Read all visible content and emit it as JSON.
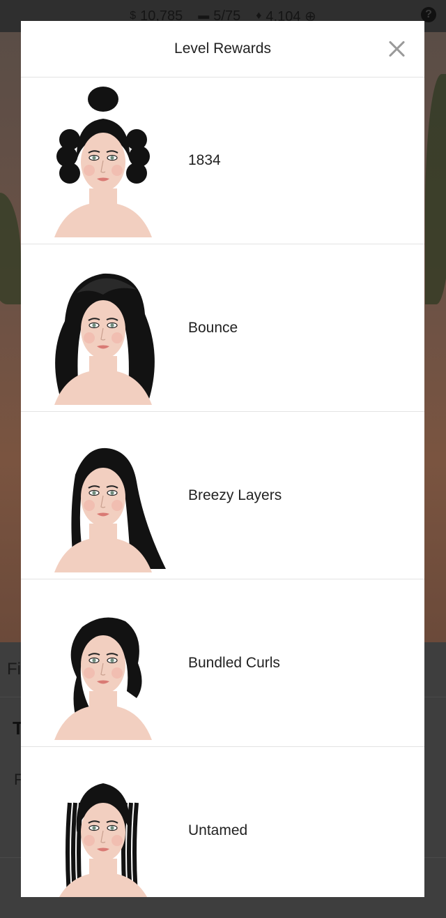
{
  "background": {
    "stats": [
      {
        "icon": "cash-icon",
        "glyph": "$",
        "value": "10,785"
      },
      {
        "icon": "ticket-icon",
        "glyph": "▬",
        "value": "5/75"
      },
      {
        "icon": "diamond-icon",
        "glyph": "♦",
        "value": "4,104 ⊕"
      }
    ],
    "help_glyph": "?",
    "partial_text": [
      "Fi",
      "T",
      "F"
    ]
  },
  "modal": {
    "title": "Level Rewards",
    "close_glyph": "×"
  },
  "rewards": [
    {
      "name": "1834",
      "style": "updo"
    },
    {
      "name": "Bounce",
      "style": "bounce"
    },
    {
      "name": "Breezy Layers",
      "style": "straight"
    },
    {
      "name": "Bundled Curls",
      "style": "side"
    },
    {
      "name": "Untamed",
      "style": "braids"
    }
  ],
  "colors": {
    "modal_bg": "#ffffff",
    "overlay": "#3a3a3a",
    "hair": "#121212",
    "skin": "#f2cfc0"
  }
}
